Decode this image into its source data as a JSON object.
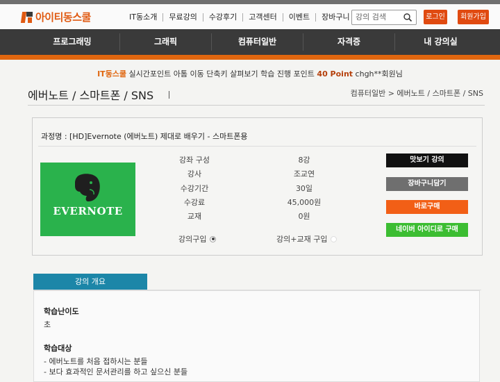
{
  "header": {
    "logo_text": "아이티동스쿨",
    "nav": [
      "IT동소개",
      "무료강의",
      "수강후기",
      "고객센터",
      "이벤트",
      "장바구니"
    ],
    "search_placeholder": "강의 검색",
    "login_label": "로그인",
    "join_label": "회원가입",
    "accent_color": "#e0660f"
  },
  "main_nav": {
    "items": [
      "프로그래밍",
      "그래픽",
      "컴퓨터일반",
      "자격증",
      "내 강의실"
    ]
  },
  "point_bar": {
    "brand": "IT동스쿨",
    "text": " 실시간포인트 아톰 이동 단축키 살펴보기 학습 진행 포인트 ",
    "points": "40 Point",
    "user": " chgh**회원님"
  },
  "page": {
    "title": "에버노트 / 스마트폰 / SNS",
    "breadcrumb": "컴퓨터일반 > 에버노트 / 스마트폰 / SNS"
  },
  "course": {
    "name": "과정명 : [HD]Evernote (에버노트) 제대로 배우기 - 스마트폰용",
    "thumbnail_text": "EVERNOTE",
    "thumbnail_icon": "evernote-elephant-icon",
    "info_labels": [
      "강좌 구성",
      "강사",
      "수강기간",
      "수강료",
      "교재"
    ],
    "info_values": [
      "8강",
      "조교연",
      "30일",
      "45,000원",
      "0원"
    ],
    "purchase_options": [
      "강의구입",
      "강의+교재 구입"
    ],
    "buttons": {
      "preview": "맛보기 강의",
      "cart": "장바구니담기",
      "buy_now": "바로구매",
      "naver_buy": "네이버 아이디로 구매"
    }
  },
  "intro": {
    "tab_label": "강의 개요",
    "level_heading": "학습난이도",
    "level_value": "초",
    "target_heading": "학습대상",
    "target_items": [
      "- 에버노트를 처음 접하시는 분들",
      "- 보다 효과적인 문서관리를 하고 싶으신 분들"
    ]
  }
}
